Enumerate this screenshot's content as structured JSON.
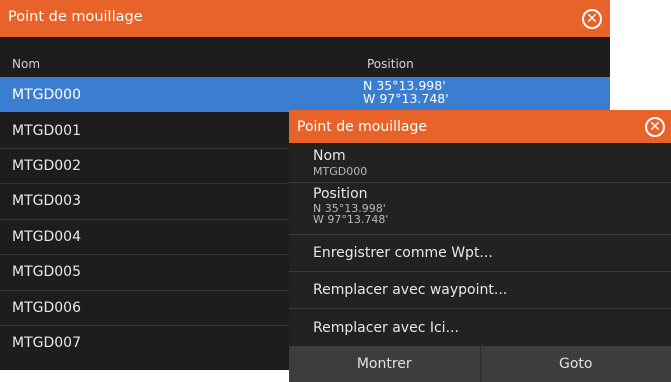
{
  "main": {
    "title": "Point de mouillage",
    "columns": {
      "name": "Nom",
      "position": "Position"
    },
    "rows": [
      {
        "name": "MTGD000",
        "lat": "N  35°13.998'",
        "lon": "W  97°13.748'",
        "selected": true
      },
      {
        "name": "MTGD001"
      },
      {
        "name": "MTGD002"
      },
      {
        "name": "MTGD003"
      },
      {
        "name": "MTGD004"
      },
      {
        "name": "MTGD005"
      },
      {
        "name": "MTGD006"
      },
      {
        "name": "MTGD007"
      }
    ]
  },
  "popup": {
    "title": "Point de mouillage",
    "name_label": "Nom",
    "name_value": "MTGD000",
    "position_label": "Position",
    "lat": "N  35°13.998'",
    "lon": "W  97°13.748'",
    "actions": [
      "Enregistrer comme  Wpt...",
      "Remplacer avec waypoint...",
      "Remplacer avec Ici..."
    ],
    "buttons": {
      "show": "Montrer",
      "goto": "Goto"
    }
  },
  "colors": {
    "titlebar": "#e8632a",
    "selected": "#3a7dd1",
    "background": "#1d1d1d"
  },
  "icons": {
    "close": "close-circle-icon"
  }
}
